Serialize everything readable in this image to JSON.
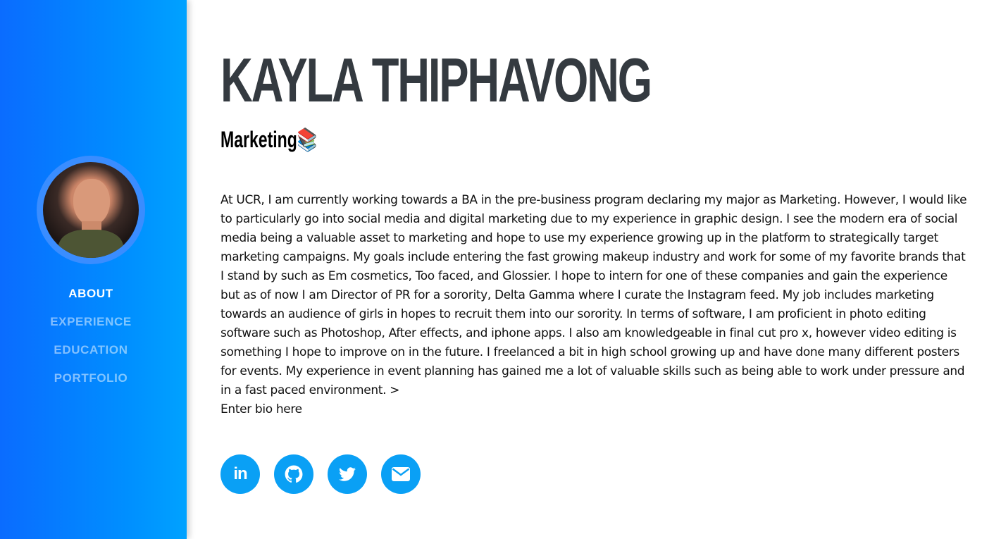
{
  "sidebar": {
    "avatar_alt": "Profile photo",
    "nav": [
      {
        "label": "ABOUT",
        "active": true
      },
      {
        "label": "EXPERIENCE",
        "active": false
      },
      {
        "label": "EDUCATION",
        "active": false
      },
      {
        "label": "PORTFOLIO",
        "active": false
      }
    ]
  },
  "main": {
    "name": "KAYLA THIPHAVONG",
    "subtitle": "Marketing📚",
    "bio": "At UCR, I am currently working towards a BA in the pre-business program declaring my major as Marketing. However, I would like to particularly go into social media and digital marketing due to my experience in graphic design. I see the modern era of social media being a valuable asset to marketing and hope to use my experience growing up in the platform to strategically target marketing campaigns. My goals include entering the fast growing makeup industry and work for some of my favorite brands that I stand by such as Em cosmetics, Too faced, and Glossier. I hope to intern for one of these companies and gain the experience but as of now I am Director of PR for a sorority, Delta Gamma where I curate the Instagram feed. My job includes marketing towards an audience of girls in hopes to recruit them into our sorority. In terms of software, I am proficient in photo editing software such as Photoshop, After effects, and iphone apps. I also am knowledgeable in final cut pro x, however video editing is something I hope to improve on in the future. I freelanced a bit in high school growing up and have done many different posters for events. My experience in event planning has gained me a lot of valuable skills such as being able to work under pressure and in a fast paced environment. >",
    "bio_extra": "Enter bio here",
    "socials": [
      {
        "icon": "linkedin-icon",
        "label": "in"
      },
      {
        "icon": "github-icon"
      },
      {
        "icon": "twitter-icon"
      },
      {
        "icon": "email-icon"
      }
    ]
  },
  "colors": {
    "sidebar_start": "#0a6cff",
    "sidebar_end": "#00a2ff",
    "heading": "#343a40",
    "social_bg": "#0aa0f5"
  }
}
